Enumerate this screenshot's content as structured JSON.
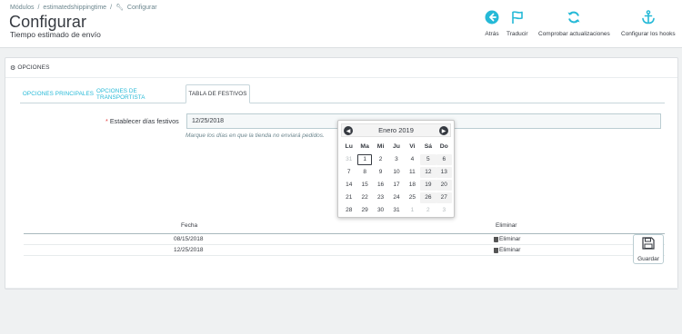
{
  "breadcrumb": {
    "item1": "Módulos",
    "sep": "/",
    "item2": "estimatedshippingtime",
    "item3": "Configurar"
  },
  "header": {
    "title": "Configurar",
    "subtitle": "Tiempo estimado de envío"
  },
  "toolbar": {
    "back": "Atrás",
    "translate": "Traducir",
    "check_updates": "Comprobar actualizaciones",
    "configure_hooks": "Configurar los hooks"
  },
  "accent_color": "#25b9d7",
  "panel": {
    "heading": "OPCIONES"
  },
  "tabs": [
    {
      "label": "OPCIONES PRINCIPALES"
    },
    {
      "label": "OPCIONES DE TRANSPORTISTA"
    },
    {
      "label": "TABLA DE FESTIVOS"
    }
  ],
  "form": {
    "required_mark": "*",
    "label": "Establecer días festivos",
    "value": "12/25/2018",
    "help": "Marque los días en que la tienda no enviará pedidos."
  },
  "datepicker": {
    "month": "Enero 2019",
    "weekdays": [
      "Lu",
      "Ma",
      "Mi",
      "Ju",
      "Vi",
      "Sá",
      "Do"
    ],
    "days": [
      [
        "31",
        "1",
        "2",
        "3",
        "4",
        "5",
        "6"
      ],
      [
        "7",
        "8",
        "9",
        "10",
        "11",
        "12",
        "13"
      ],
      [
        "14",
        "15",
        "16",
        "17",
        "18",
        "19",
        "20"
      ],
      [
        "21",
        "22",
        "23",
        "24",
        "25",
        "26",
        "27"
      ],
      [
        "28",
        "29",
        "30",
        "31",
        "1",
        "2",
        "3"
      ]
    ]
  },
  "holidays_table": {
    "columns": [
      "Fecha",
      "Eliminar"
    ],
    "rows": [
      {
        "date": "08/15/2018",
        "action": "Eliminar"
      },
      {
        "date": "12/25/2018",
        "action": "Eliminar"
      }
    ]
  },
  "footer": {
    "save": "Guardar"
  }
}
